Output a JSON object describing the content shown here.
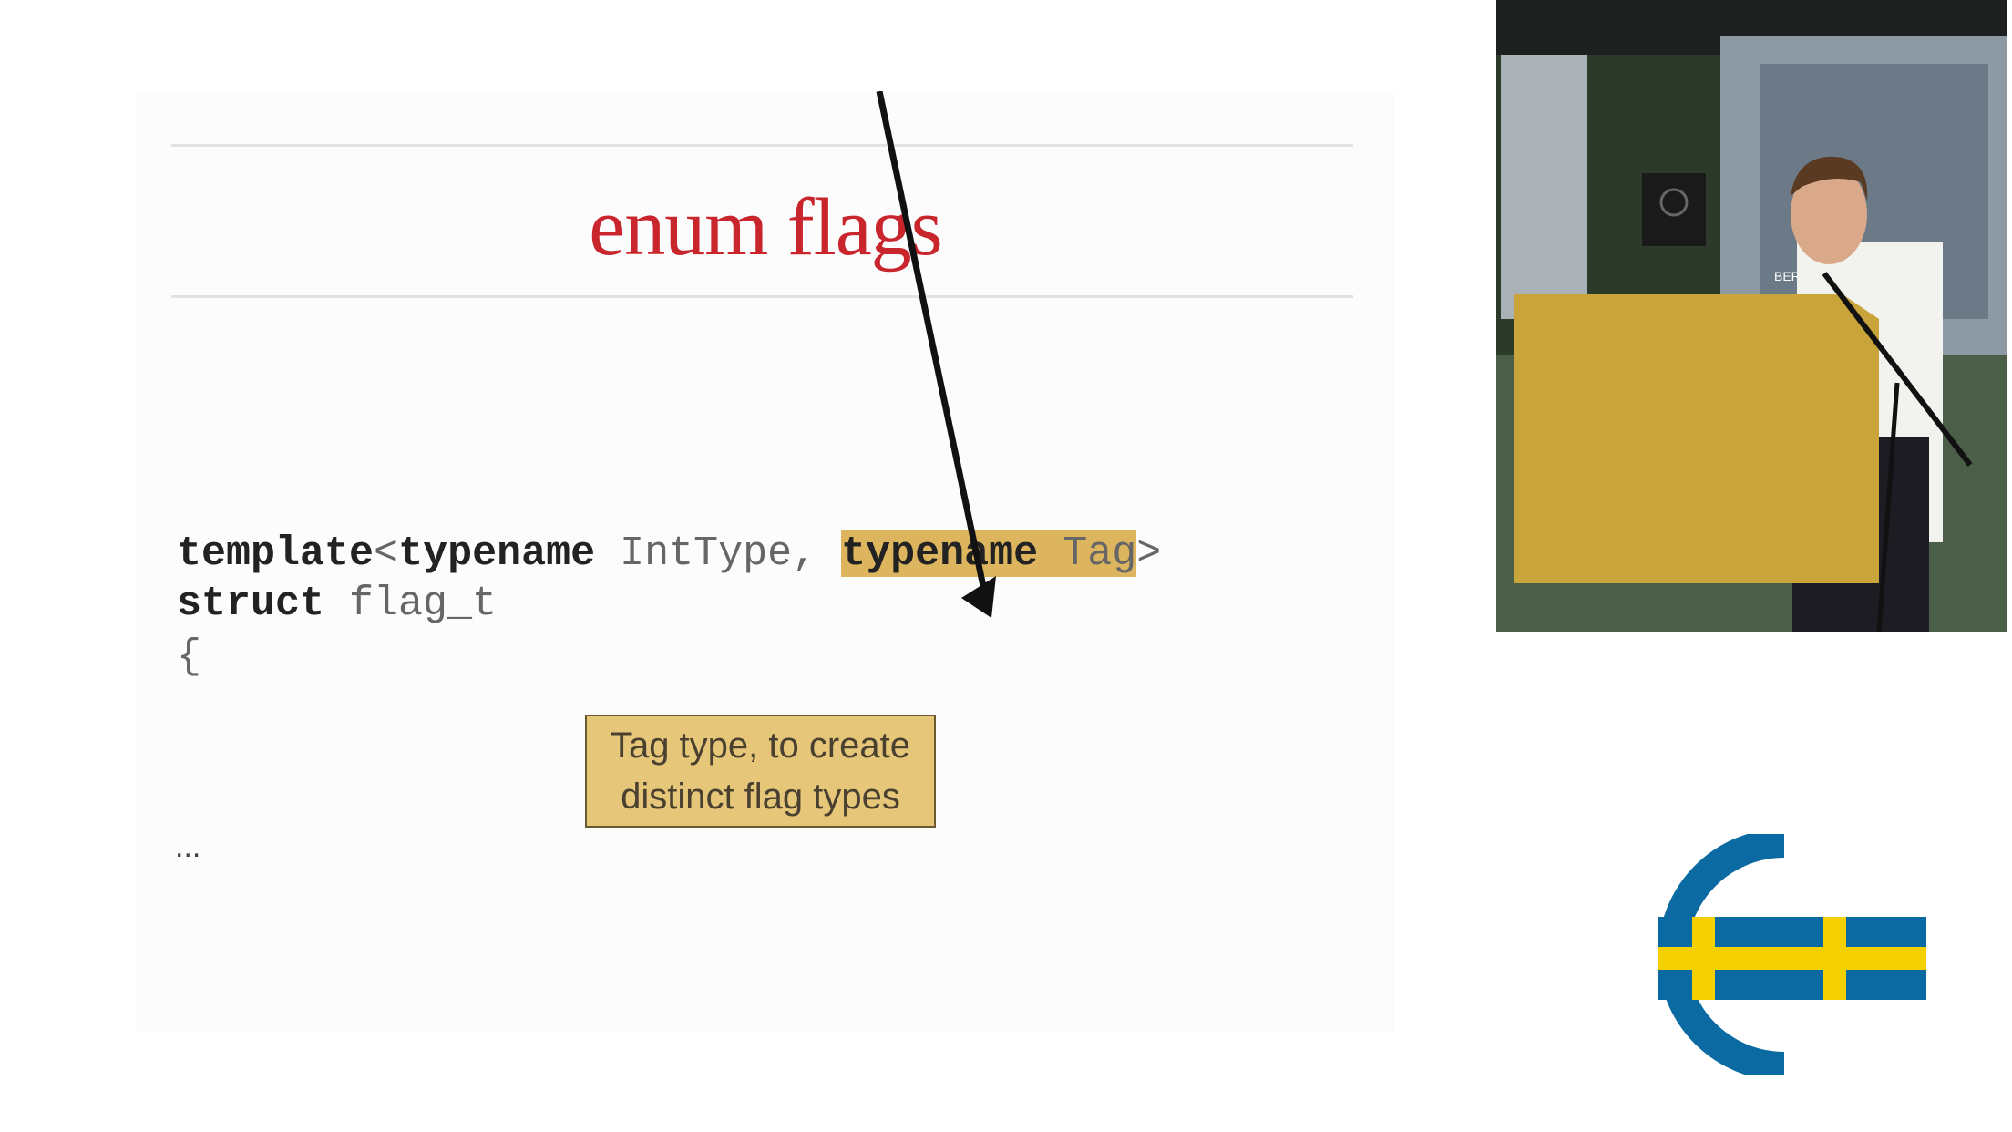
{
  "slide": {
    "title": "enum flags",
    "code": {
      "line1": {
        "kw1": "template",
        "p1": "<",
        "kw2": "typename",
        "p2": " IntType, ",
        "hl_kw": "typename",
        "hl_rest": " Tag",
        "p3": ">"
      },
      "line2": {
        "kw": "struct",
        "rest": " flag_t"
      },
      "line3": "{",
      "ellipsis": "..."
    },
    "callout": {
      "line1": "Tag type, to create",
      "line2": "distinct flag types"
    }
  },
  "video": {
    "screen_text": "BER"
  },
  "colors": {
    "title": "#c8262c",
    "highlight": "#dcb55e",
    "callout_bg": "#e6c77a",
    "logo_blue": "#0a6aa1",
    "logo_yellow": "#f5d000"
  }
}
